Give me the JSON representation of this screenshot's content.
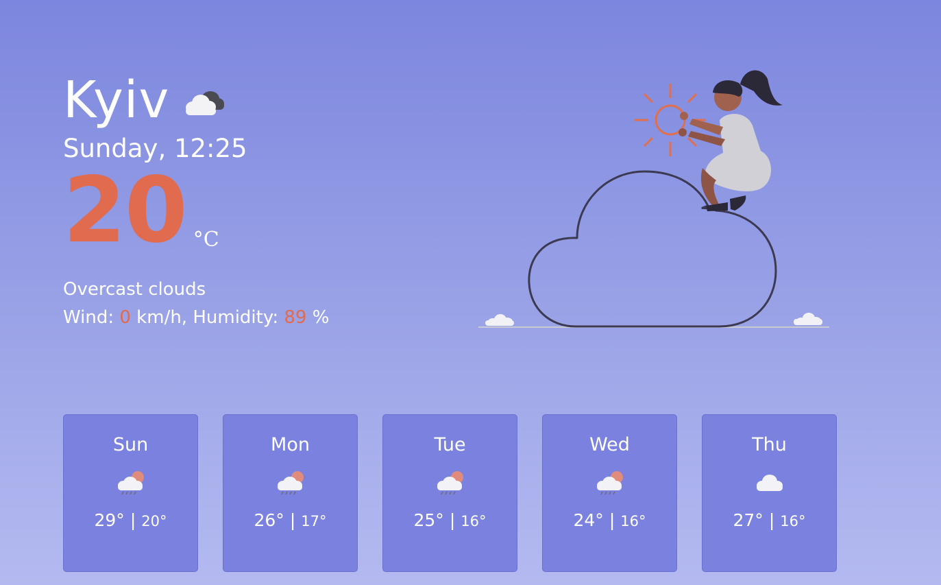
{
  "current": {
    "city": "Kyiv",
    "icon": "overcast-cloud-icon",
    "datetime": "Sunday, 12:25",
    "temperature": "20",
    "unit": "°C",
    "description": "Overcast clouds",
    "wind_label": "Wind: ",
    "wind_value": "0",
    "wind_unit": " km/h, Humidity: ",
    "humidity_value": "89",
    "humidity_unit": " %"
  },
  "colors": {
    "accent": "#e06b4e",
    "card_bg": "#7b81de",
    "text": "#ffffff"
  },
  "forecast": [
    {
      "day": "Sun",
      "icon": "rain-sun-cloud-icon",
      "max": "29°",
      "sep": "|",
      "min": "20°"
    },
    {
      "day": "Mon",
      "icon": "rain-sun-cloud-icon",
      "max": "26°",
      "sep": "|",
      "min": "17°"
    },
    {
      "day": "Tue",
      "icon": "rain-sun-cloud-icon",
      "max": "25°",
      "sep": "|",
      "min": "16°"
    },
    {
      "day": "Wed",
      "icon": "rain-sun-cloud-icon",
      "max": "24°",
      "sep": "|",
      "min": "16°"
    },
    {
      "day": "Thu",
      "icon": "cloud-icon",
      "max": "27°",
      "sep": "|",
      "min": "16°"
    }
  ]
}
